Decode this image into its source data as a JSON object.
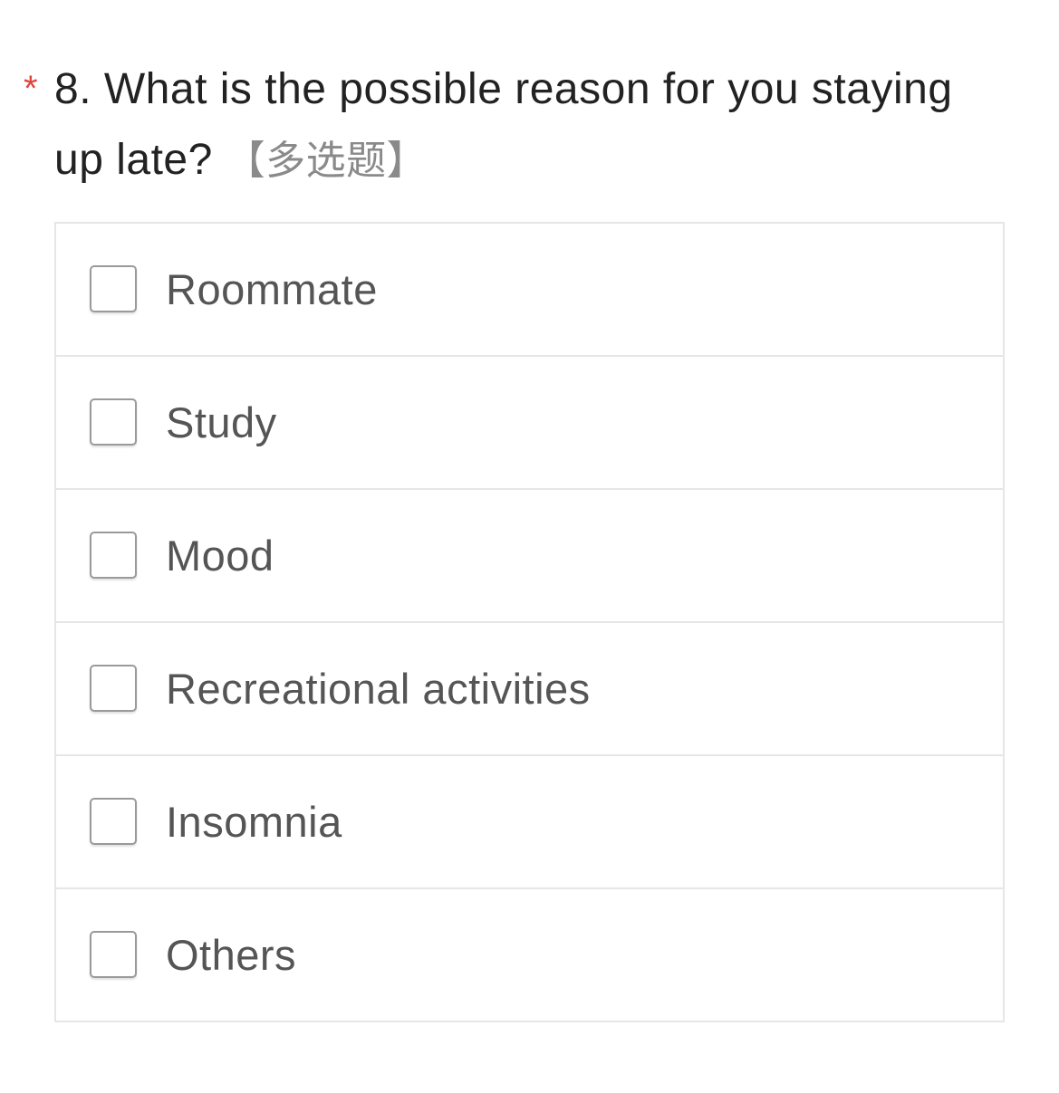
{
  "question": {
    "required_mark": "*",
    "title": "8. What is the possible reason for you staying up late?",
    "type_tag": "【多选题】"
  },
  "options": [
    {
      "label": "Roommate",
      "checked": false
    },
    {
      "label": "Study",
      "checked": false
    },
    {
      "label": "Mood",
      "checked": false
    },
    {
      "label": "Recreational activities",
      "checked": false
    },
    {
      "label": "Insomnia",
      "checked": false
    },
    {
      "label": "Others",
      "checked": false
    }
  ],
  "colors": {
    "required": "#e0453b",
    "title": "#222222",
    "type_tag": "#8a8a8a",
    "option_text": "#555555",
    "border": "#e6e6e6"
  }
}
